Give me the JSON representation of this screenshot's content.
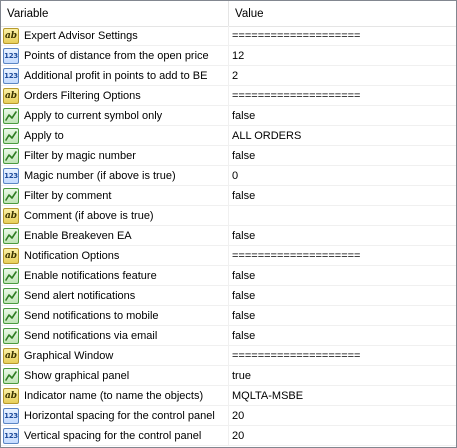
{
  "header": {
    "variable": "Variable",
    "value": "Value"
  },
  "rows": [
    {
      "type": "ab",
      "label": "Expert Advisor Settings",
      "value": "===================="
    },
    {
      "type": "num",
      "label": "Points of distance from the open price",
      "value": "12"
    },
    {
      "type": "num",
      "label": "Additional profit in points to add to BE",
      "value": "2"
    },
    {
      "type": "ab",
      "label": "Orders Filtering Options",
      "value": "===================="
    },
    {
      "type": "bool",
      "label": "Apply to current symbol only",
      "value": "false"
    },
    {
      "type": "bool",
      "label": "Apply to",
      "value": "ALL ORDERS"
    },
    {
      "type": "bool",
      "label": "Filter by magic number",
      "value": "false"
    },
    {
      "type": "num",
      "label": "Magic number (if above is true)",
      "value": "0"
    },
    {
      "type": "bool",
      "label": "Filter by comment",
      "value": "false"
    },
    {
      "type": "ab",
      "label": "Comment (if above is true)",
      "value": ""
    },
    {
      "type": "bool",
      "label": "Enable Breakeven EA",
      "value": "false"
    },
    {
      "type": "ab",
      "label": "Notification Options",
      "value": "===================="
    },
    {
      "type": "bool",
      "label": "Enable notifications feature",
      "value": "false"
    },
    {
      "type": "bool",
      "label": "Send alert notifications",
      "value": "false"
    },
    {
      "type": "bool",
      "label": "Send notifications to mobile",
      "value": "false"
    },
    {
      "type": "bool",
      "label": "Send notifications via email",
      "value": "false"
    },
    {
      "type": "ab",
      "label": "Graphical Window",
      "value": "===================="
    },
    {
      "type": "bool",
      "label": "Show graphical panel",
      "value": "true"
    },
    {
      "type": "ab",
      "label": "Indicator name (to name the objects)",
      "value": "MQLTA-MSBE"
    },
    {
      "type": "num",
      "label": "Horizontal spacing for the control panel",
      "value": "20"
    },
    {
      "type": "num",
      "label": "Vertical spacing for the control panel",
      "value": "20"
    }
  ],
  "icon_glyphs": {
    "ab": "ab",
    "num": "123"
  },
  "icon_names": {
    "ab": "string-type-icon",
    "num": "number-type-icon",
    "bool": "boolean-type-icon"
  }
}
